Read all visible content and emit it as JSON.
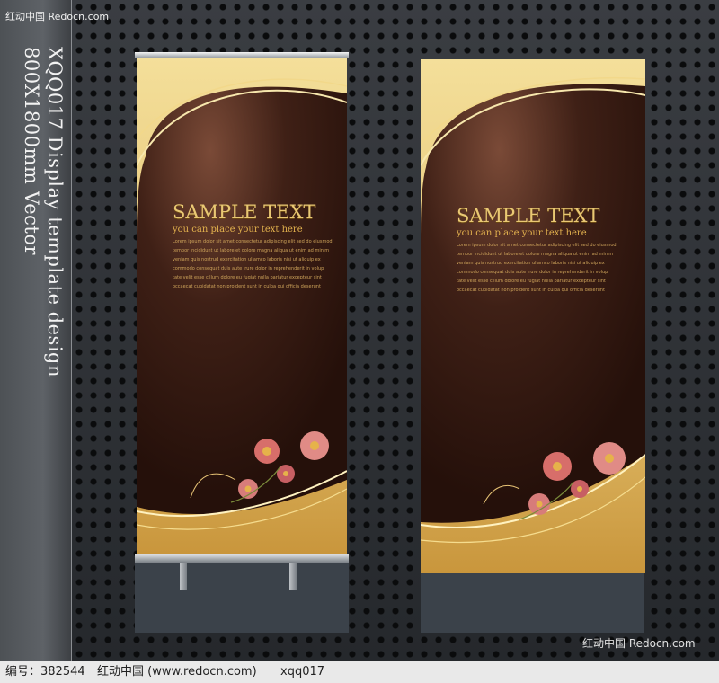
{
  "watermark_top": "红动中国 Redocn.com",
  "vertical_caption": [
    "XQQ017 Display template design",
    "800X1800mm Vector"
  ],
  "banners": [
    {
      "title": "SAMPLE TEXT",
      "subtitle": "you can place your text here",
      "body": [
        "Lorem ipsum dolor sit amet consectetur adipiscing elit sed do eiusmod",
        "tempor incididunt ut labore et dolore magna aliqua ut enim ad minim",
        "veniam quis nostrud exercitation ullamco laboris nisi ut aliquip ex",
        "commodo consequat duis aute irure dolor in reprehenderit in volup",
        "tate velit esse cillum dolore eu fugiat nulla pariatur excepteur sint",
        "occaecat cupidatat non proident sunt in culpa qui officia deserunt"
      ]
    },
    {
      "title": "SAMPLE TEXT",
      "subtitle": "you can place your text here",
      "body": [
        "Lorem ipsum dolor sit amet consectetur adipiscing elit sed do eiusmod",
        "tempor incididunt ut labore et dolore magna aliqua ut enim ad minim",
        "veniam quis nostrud exercitation ullamco laboris nisi ut aliquip ex",
        "commodo consequat duis aute irure dolor in reprehenderit in volup",
        "tate velit esse cillum dolore eu fugiat nulla pariatur excepteur sint",
        "occaecat cupidatat non proident sunt in culpa qui officia deserunt"
      ]
    }
  ],
  "watermark_bottom_right": "红动中国 Redocn.com",
  "footer": {
    "id_label": "编号：382544",
    "site": "红动中国 (www.redocn.com)",
    "code": "xqq017"
  },
  "colors": {
    "gold": "#e9c874",
    "brown": "#2a1209",
    "background": "#2d3034"
  }
}
